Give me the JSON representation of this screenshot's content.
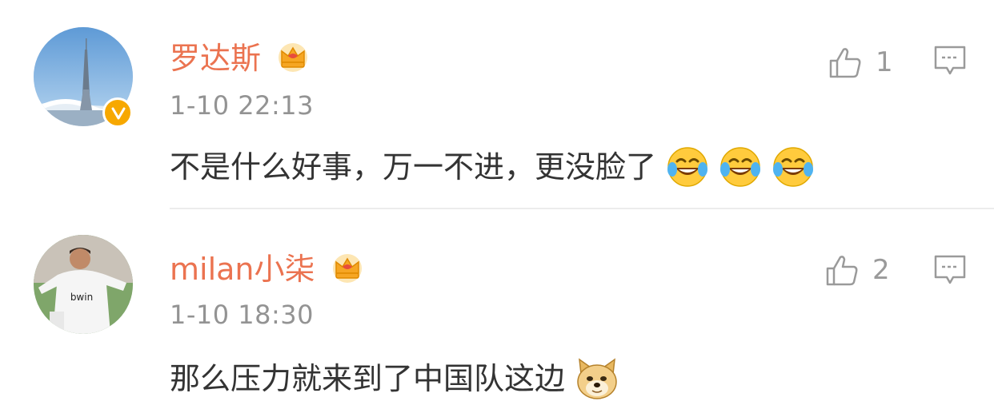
{
  "comments": [
    {
      "username": "罗达斯",
      "timestamp": "1-10 22:13",
      "text": "不是什么好事，万一不进，更没脸了",
      "likes": "1",
      "verified": true,
      "emojis": [
        "laugh-cry-icon",
        "laugh-cry-icon",
        "laugh-cry-icon"
      ]
    },
    {
      "username": "milan小柒",
      "timestamp": "1-10 18:30",
      "text": "那么压力就来到了中国队这边",
      "likes": "2",
      "verified": false,
      "emojis": [
        "doge-icon"
      ]
    }
  ],
  "colors": {
    "username": "#eb7350",
    "timestamp": "#939393",
    "body_text": "#333333",
    "icon_gray": "#9a9a9a",
    "verified_badge": "#f7a800"
  }
}
